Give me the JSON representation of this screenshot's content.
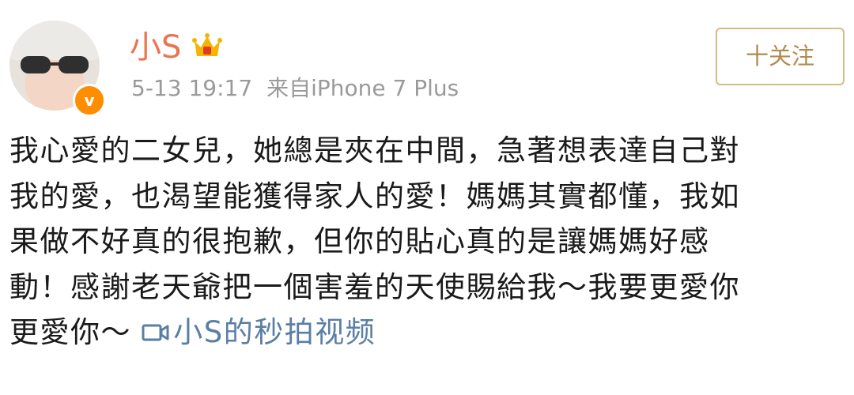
{
  "post": {
    "username": "小S",
    "timestamp": "5-13 19:17",
    "source": "来自iPhone 7 Plus",
    "follow_label": "十关注",
    "content_lines": [
      "我心愛的二女兒，她總是夾在中間，急著想表達自己對",
      "我的愛，也渴望能獲得家人的愛！媽媽其實都懂，我如",
      "果做不好真的很抱歉，但你的貼心真的是讓媽媽好感",
      "動！感謝老天爺把一個害羞的天使賜給我～我要更愛你"
    ],
    "content_last_line": "更愛你～ ",
    "video_link_label": "小S的秒拍视频",
    "verified_badge": "v"
  },
  "icons": {
    "avatar": "avatar",
    "verified": "verified-badge-icon",
    "member": "crown-icon",
    "video": "video-camera-icon"
  },
  "colors": {
    "username": "#eb7350",
    "meta": "#9a9a9a",
    "follow_border": "#d8b982",
    "follow_text": "#b28a50",
    "link": "#5a7ea5",
    "badge": "#ff8d00",
    "crown": "#f5b400"
  }
}
